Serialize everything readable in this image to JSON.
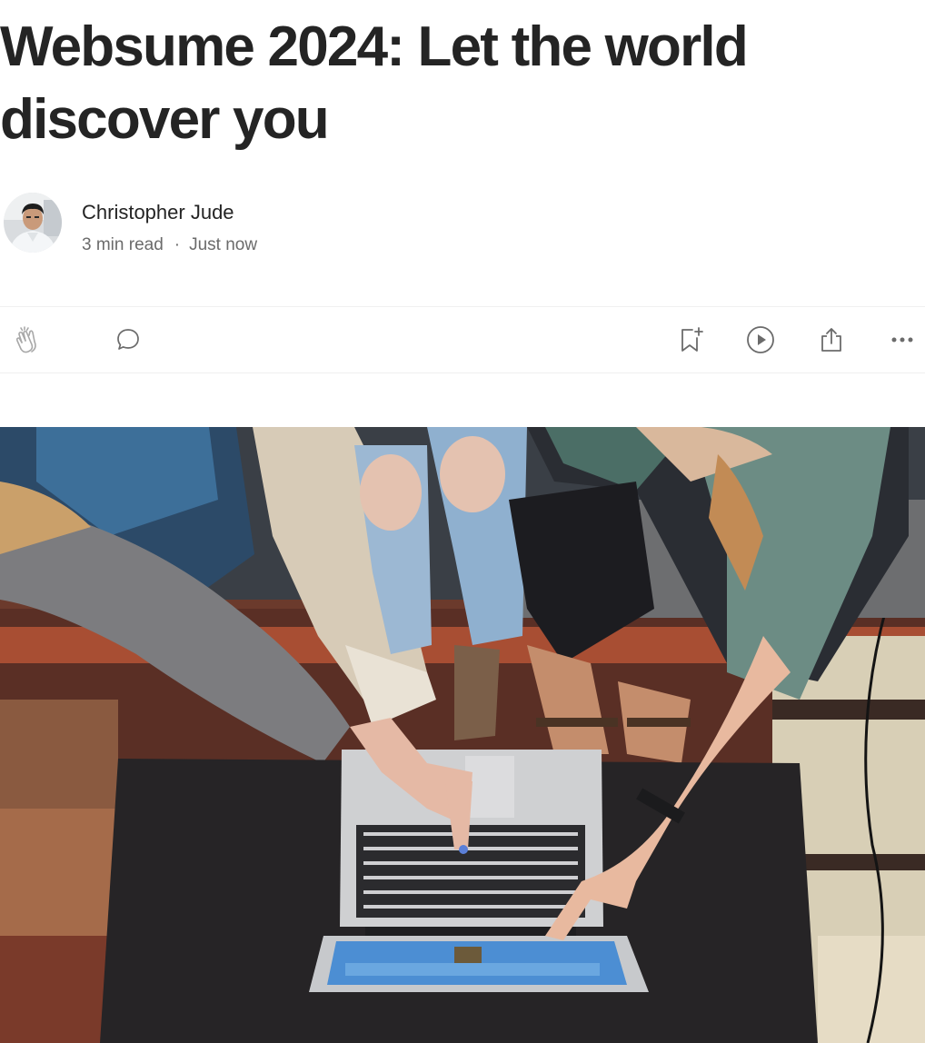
{
  "article": {
    "title": "Websume 2024: Let the world discover you",
    "author": "Christopher Jude",
    "read_time": "3 min read",
    "dot": "·",
    "published": "Just now"
  },
  "actions": {
    "icons": [
      "clap-icon",
      "comment-icon",
      "bookmark-add-icon",
      "play-icon",
      "share-icon",
      "more-icon"
    ]
  },
  "colors": {
    "text": "#242424",
    "muted": "#6b6b6b",
    "icon": "#6b6b6b",
    "divider": "#f0f0f0"
  }
}
